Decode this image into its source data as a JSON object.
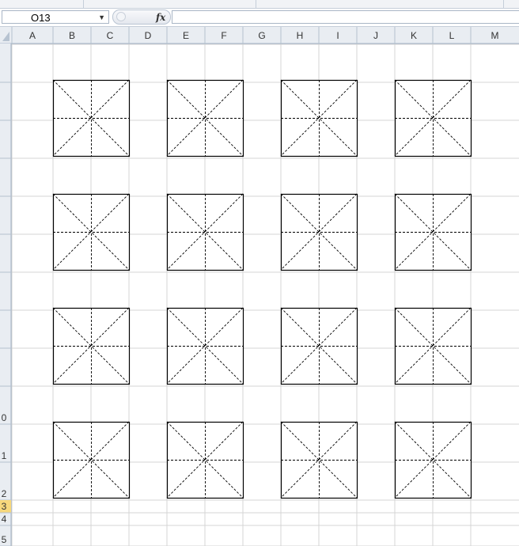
{
  "formula_bar": {
    "name_box_value": "O13",
    "fx_label": "fx",
    "formula_value": ""
  },
  "columns": [
    "A",
    "B",
    "C",
    "D",
    "E",
    "F",
    "G",
    "H",
    "I",
    "J",
    "K",
    "L",
    "M"
  ],
  "rows": [
    "",
    "",
    "",
    "",
    "",
    "",
    "",
    "",
    "",
    "0",
    "1",
    "2",
    "3",
    "4",
    "5"
  ],
  "selected_row": "3",
  "grid": {
    "box_rows": 4,
    "box_cols": 4
  },
  "colors": {
    "header_bg": "#e9edf2",
    "selected_header_bg": "#f7d87c",
    "gridline": "#d4d4d4",
    "box_stroke": "#000000"
  }
}
